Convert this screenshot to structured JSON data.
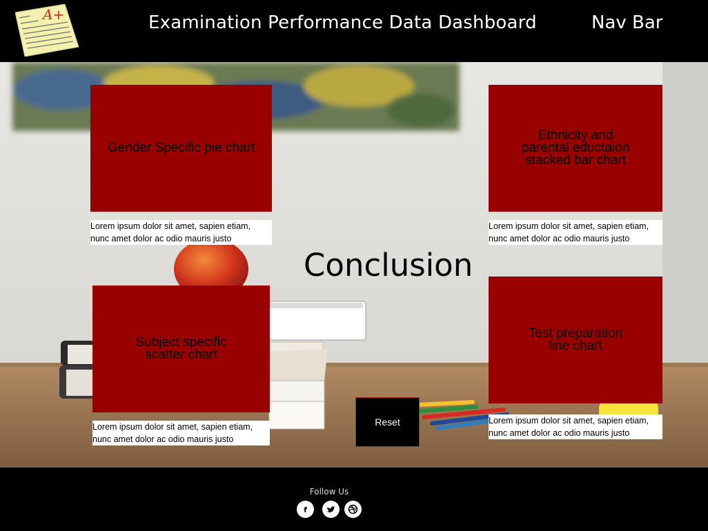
{
  "header": {
    "title": "Examination Performance Data Dashboard",
    "nav_label": "Nav Bar",
    "logo_icon": "graded-paper-a-plus-icon",
    "logo_grade": "A+"
  },
  "cards": [
    {
      "id": "gender",
      "lines": [
        "Gender Specific pie  chart"
      ],
      "description": [
        "Lorem ipsum dolor sit amet, sapien etiam,",
        "nunc amet dolor ac odio mauris justo"
      ]
    },
    {
      "id": "ethnicity",
      "lines": [
        "Ethnicity and",
        "parental eductaion",
        "stacked bar chart"
      ],
      "description": [
        "Lorem ipsum dolor sit amet, sapien etiam,",
        "nunc amet dolor ac odio mauris justo"
      ]
    },
    {
      "id": "subject",
      "lines": [
        "Subject specific",
        "scatter chart"
      ],
      "description": [
        "Lorem ipsum dolor sit amet, sapien etiam,",
        "nunc amet dolor ac odio mauris justo"
      ]
    },
    {
      "id": "test-prep",
      "lines": [
        "Test preparation",
        "line chart"
      ],
      "description": [
        "Lorem ipsum dolor sit amet, sapien etiam,",
        "nunc amet dolor ac odio mauris justo"
      ]
    }
  ],
  "main": {
    "conclusion": "Conclusion",
    "reset_label": "Reset"
  },
  "footer": {
    "follow_label": "Follow Us",
    "social": [
      {
        "name": "facebook-icon",
        "glyph": "f"
      },
      {
        "name": "twitter-icon",
        "glyph": "bird"
      },
      {
        "name": "dribbble-icon",
        "glyph": "ball"
      }
    ]
  },
  "colors": {
    "card_background": "#990000",
    "header_background": "#000000",
    "footer_background": "#000000",
    "reset_border": "#b3261e"
  }
}
